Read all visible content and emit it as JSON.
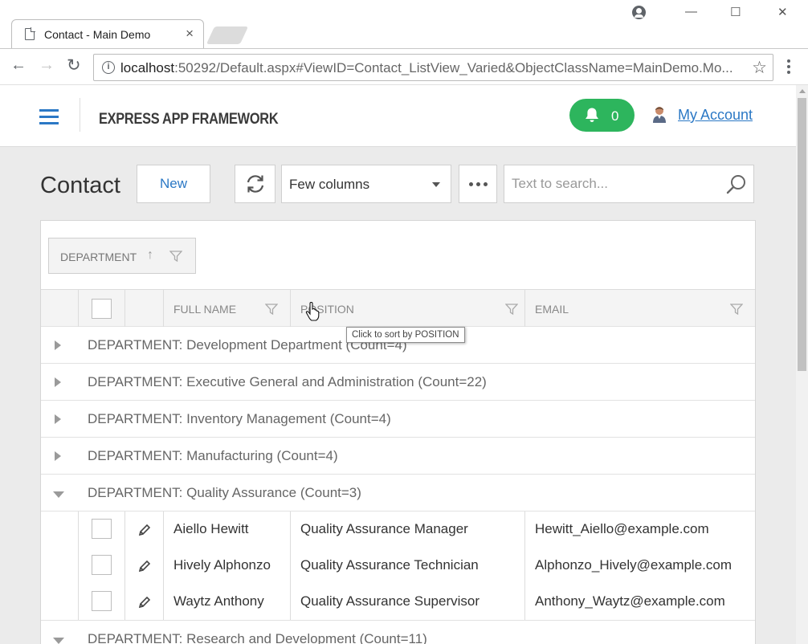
{
  "browser": {
    "tab_title": "Contact - Main Demo",
    "tab_close": "×",
    "url_host": "localhost",
    "url_rest": ":50292/Default.aspx#ViewID=Contact_ListView_Varied&ObjectClassName=MainDemo.Mo...",
    "window_controls": {
      "minimize": "—",
      "maximize": "☐",
      "close": "✕"
    },
    "nav": {
      "back": "←",
      "forward": "→",
      "reload": "↻"
    },
    "info": "i",
    "bookmark": "☆"
  },
  "header": {
    "brand": "EXPRESS APP FRAMEWORK",
    "notifications_count": "0",
    "account": "My Account",
    "accent": "#2b78c5",
    "notif_color": "#2db55d"
  },
  "toolbar": {
    "page_title": "Contact",
    "new_label": "New",
    "view_variant": "Few columns",
    "more": "•••",
    "search_placeholder": "Text to search..."
  },
  "grid": {
    "group_panel": {
      "label": "DEPARTMENT",
      "sort": "↑"
    },
    "columns": [
      "FULL NAME",
      "POSITION",
      "EMAIL"
    ],
    "groups": [
      {
        "text": "DEPARTMENT: Development Department (Count=4)",
        "expanded": false
      },
      {
        "text": "DEPARTMENT: Executive General and Administration (Count=22)",
        "expanded": false
      },
      {
        "text": "DEPARTMENT: Inventory Management (Count=4)",
        "expanded": false
      },
      {
        "text": "DEPARTMENT: Manufacturing (Count=4)",
        "expanded": false
      },
      {
        "text": "DEPARTMENT: Quality Assurance (Count=3)",
        "expanded": true
      },
      {
        "text": "DEPARTMENT: Research and Development (Count=11)",
        "expanded": true
      }
    ],
    "rows": [
      {
        "full_name": "Aiello Hewitt",
        "position": "Quality Assurance Manager",
        "email": "Hewitt_Aiello@example.com"
      },
      {
        "full_name": "Hively Alphonzo",
        "position": "Quality Assurance Technician",
        "email": "Alphonzo_Hively@example.com"
      },
      {
        "full_name": "Waytz Anthony",
        "position": "Quality Assurance Supervisor",
        "email": "Anthony_Waytz@example.com"
      }
    ],
    "tooltip": "Click to sort by POSITION"
  }
}
